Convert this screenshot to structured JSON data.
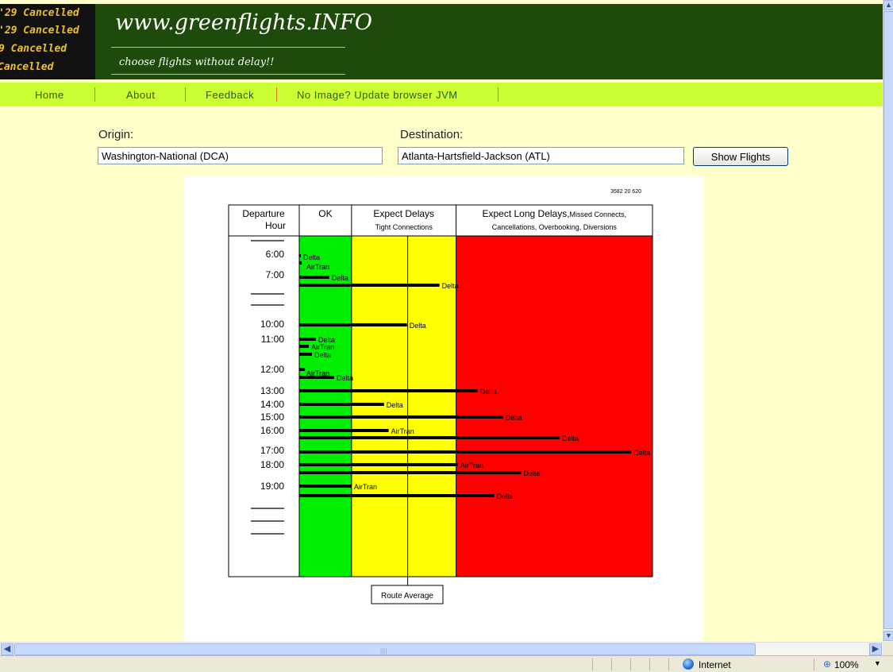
{
  "logo": {
    "board_rows": [
      "'29 Cancelled",
      "'29 Cancelled",
      "9 Cancelled",
      "Cancelled"
    ],
    "board_color": "#f0c020"
  },
  "site": {
    "title": "www.greenflights.INFO",
    "tagline": "choose flights without delay!!"
  },
  "nav": {
    "home": "Home",
    "about": "About",
    "feedback": "Feedback",
    "jvm": "No Image?  Update browser JVM"
  },
  "form": {
    "origin_label": "Origin:",
    "origin_value": "Washington-National (DCA)",
    "destination_label": "Destination:",
    "destination_value": "Atlanta-Hartsfield-Jackson (ATL)",
    "show_button": "Show Flights"
  },
  "chart": {
    "corner_code": "3582 20 620",
    "col_hour_line1": "Departure",
    "col_hour_line2": "Hour",
    "col_ok": "OK",
    "col_delays_title": "Expect Delays",
    "col_delays_sub": "Tight Connections",
    "col_long_title": "Expect Long Delays,",
    "col_long_extra": "Missed Connects,",
    "col_long_sub": "Cancellations, Overbooking, Diversions",
    "route_average_label": "Route Average",
    "colors": {
      "ok": "#00ee00",
      "delays": "#ffff00",
      "long": "#ff0000",
      "bar": "#000000"
    }
  },
  "chart_data": {
    "type": "bar",
    "orientation": "horizontal",
    "hour_labels": [
      "",
      "6:00",
      "7:00",
      "",
      "",
      "10:00",
      "11:00",
      "12:00",
      "13:00",
      "14:00",
      "15:00",
      "16:00",
      "17:00",
      "18:00",
      "19:00",
      "",
      "",
      ""
    ],
    "delay_scale": "relative (0 = left edge of OK zone, 1 = right edge of Long Delays zone)",
    "zone_bounds": {
      "ok_end": 0.148,
      "delays_end": 0.444
    },
    "route_average": 0.307,
    "flights": [
      {
        "hour": "6:00",
        "airline": "Delta",
        "delay": 0.0
      },
      {
        "hour": "6:00",
        "airline": "AirTran",
        "delay": 0.007
      },
      {
        "hour": "7:00",
        "airline": "Delta",
        "delay": 0.085
      },
      {
        "hour": "7:00",
        "airline": "Delta",
        "delay": 0.397
      },
      {
        "hour": "10:00",
        "airline": "Delta",
        "delay": 0.305
      },
      {
        "hour": "11:00",
        "airline": "Delta",
        "delay": 0.047
      },
      {
        "hour": "11:00",
        "airline": "AirTran",
        "delay": 0.027
      },
      {
        "hour": "11:00",
        "airline": "Delta",
        "delay": 0.036
      },
      {
        "hour": "12:00",
        "airline": "AirTran",
        "delay": 0.016
      },
      {
        "hour": "12:00",
        "airline": "Delta",
        "delay": 0.099
      },
      {
        "hour": "13:00",
        "airline": "Delta",
        "delay": 0.505
      },
      {
        "hour": "14:00",
        "airline": "Delta",
        "delay": 0.24
      },
      {
        "hour": "15:00",
        "airline": "Delta",
        "delay": 0.577
      },
      {
        "hour": "16:00",
        "airline": "AirTran",
        "delay": 0.253
      },
      {
        "hour": "16:00",
        "airline": "Delta",
        "delay": 0.737
      },
      {
        "hour": "17:00",
        "airline": "Delta",
        "delay": 0.94
      },
      {
        "hour": "18:00",
        "airline": "AirTran",
        "delay": 0.449
      },
      {
        "hour": "18:00",
        "airline": "Delta",
        "delay": 0.628
      },
      {
        "hour": "19:00",
        "airline": "AirTran",
        "delay": 0.148
      },
      {
        "hour": "19:00",
        "airline": "Delta",
        "delay": 0.552
      }
    ]
  },
  "status": {
    "zone": "Internet",
    "zoom": "100%"
  }
}
